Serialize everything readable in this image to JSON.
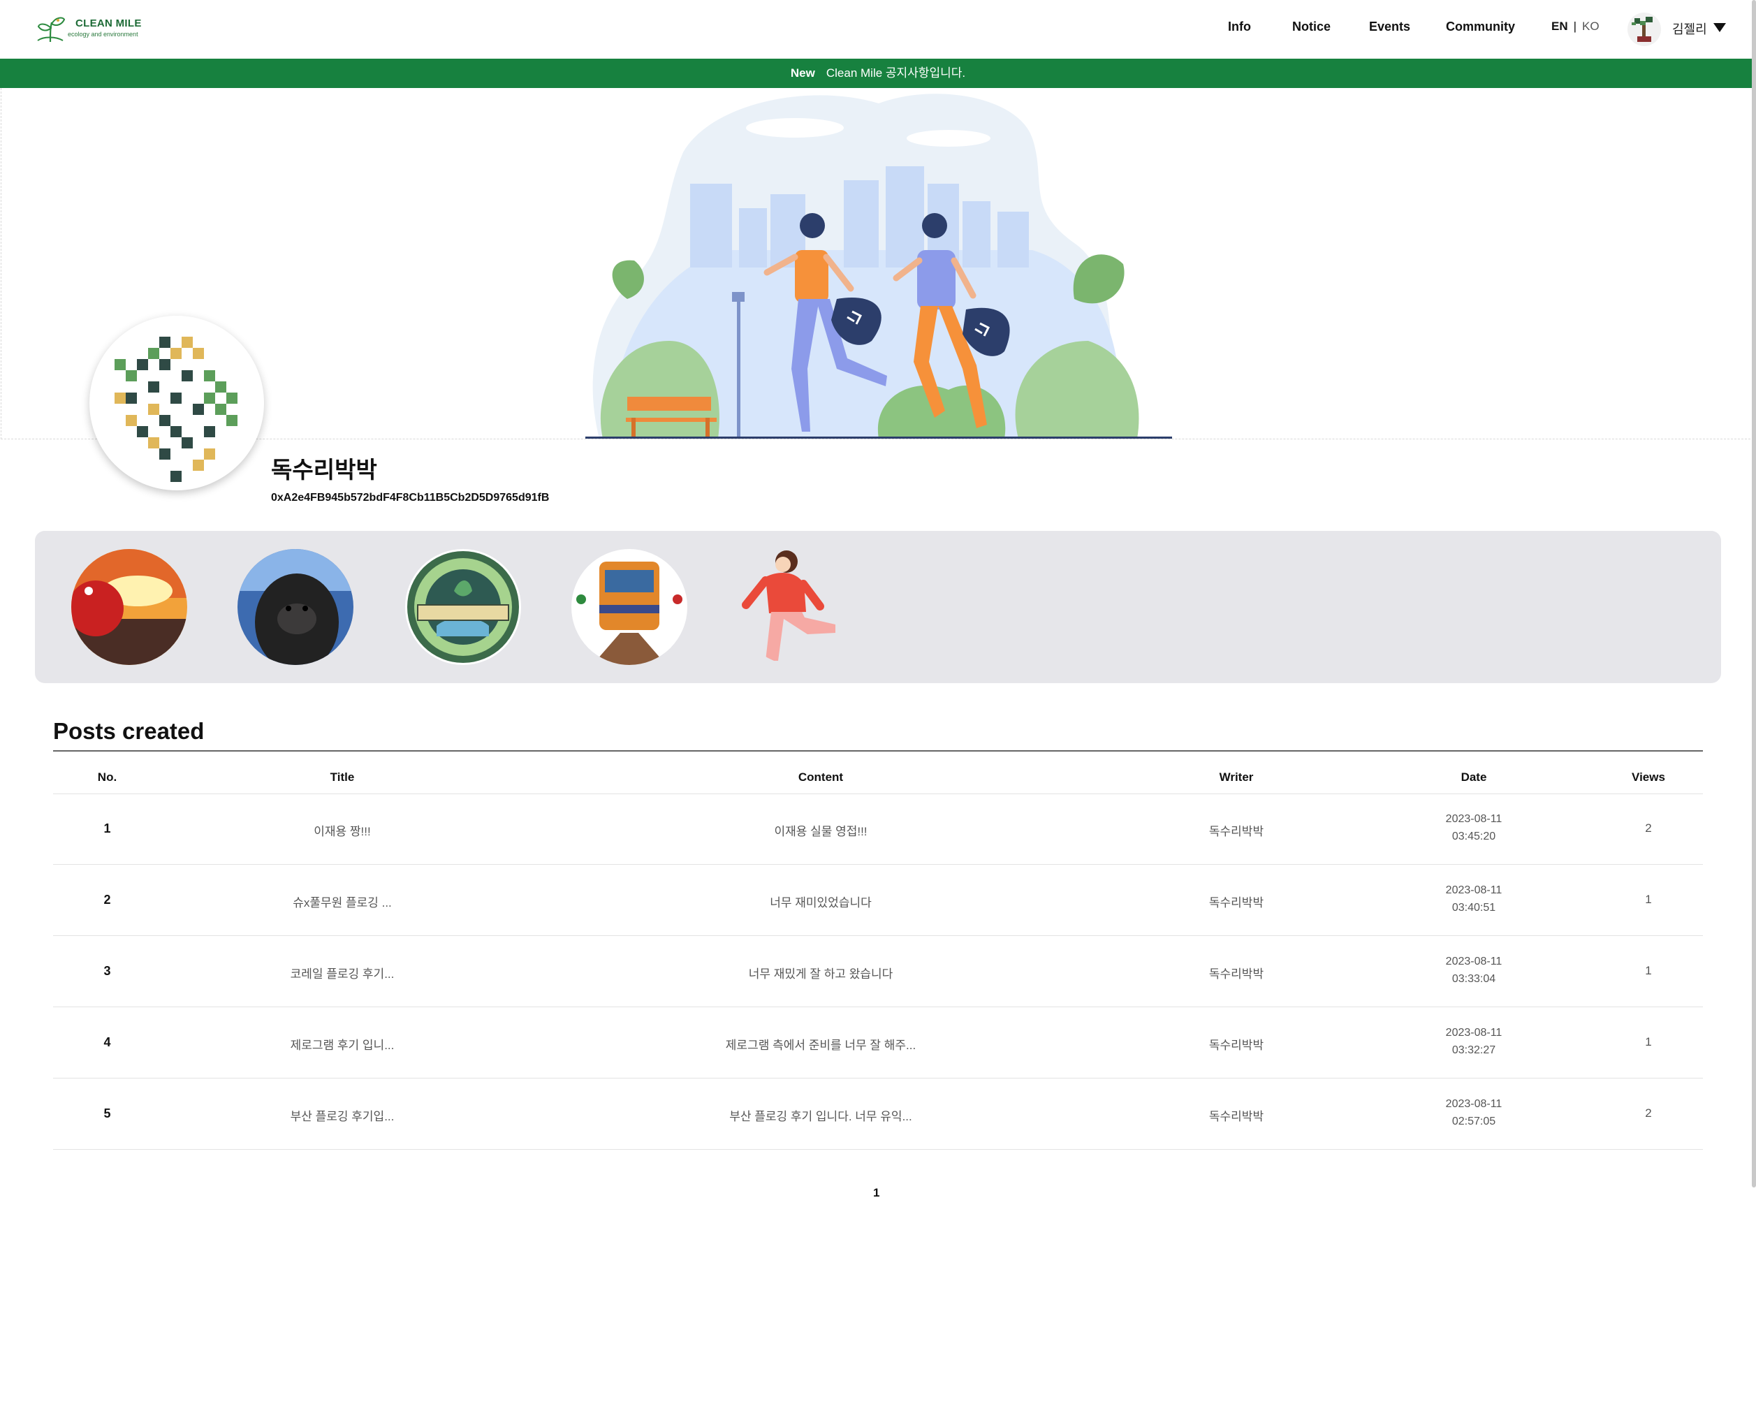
{
  "brand": {
    "title": "CLEAN MILE",
    "subtitle": "ecology and environment",
    "logo_icon": "leaf-sprout-icon"
  },
  "nav": {
    "links": [
      "Info",
      "Notice",
      "Events",
      "Community"
    ],
    "lang_en": "EN",
    "lang_sep": "|",
    "lang_ko": "KO",
    "user_name": "김젤리"
  },
  "notice": {
    "badge": "New",
    "text": "Clean Mile 공지사항입니다."
  },
  "profile": {
    "name": "독수리박박",
    "address": "0xA2e4FB945b572bdF4F8Cb11B5Cb2D5D9765d91fB"
  },
  "nfts": [
    "sunset-creature-nft",
    "gorilla-nft",
    "environment-badge-nft",
    "train-nft",
    "running-girl-nft"
  ],
  "posts": {
    "title": "Posts created",
    "columns": [
      "No.",
      "Title",
      "Content",
      "Writer",
      "Date",
      "Views"
    ],
    "rows": [
      {
        "no": "1",
        "title": "이재용 짱!!!",
        "content": "이재용 실물 영접!!!",
        "writer": "독수리박박",
        "date": "2023-08-11",
        "time": "03:45:20",
        "views": "2"
      },
      {
        "no": "2",
        "title": "슈x풀무원 플로깅 ...",
        "content": "너무 재미있었습니다",
        "writer": "독수리박박",
        "date": "2023-08-11",
        "time": "03:40:51",
        "views": "1"
      },
      {
        "no": "3",
        "title": "코레일 플로깅 후기...",
        "content": "너무 재밌게 잘 하고 왔습니다",
        "writer": "독수리박박",
        "date": "2023-08-11",
        "time": "03:33:04",
        "views": "1"
      },
      {
        "no": "4",
        "title": "제로그램 후기 입니...",
        "content": "제로그램 측에서 준비를 너무 잘 해주...",
        "writer": "독수리박박",
        "date": "2023-08-11",
        "time": "03:32:27",
        "views": "1"
      },
      {
        "no": "5",
        "title": "부산 플로깅 후기입...",
        "content": "부산 플로깅 후기 입니다. 너무 유익...",
        "writer": "독수리박박",
        "date": "2023-08-11",
        "time": "02:57:05",
        "views": "2"
      }
    ]
  },
  "pagination": {
    "current": "1"
  },
  "colors": {
    "brand_green": "#17813f",
    "panel_gray": "#e6e6ea"
  }
}
